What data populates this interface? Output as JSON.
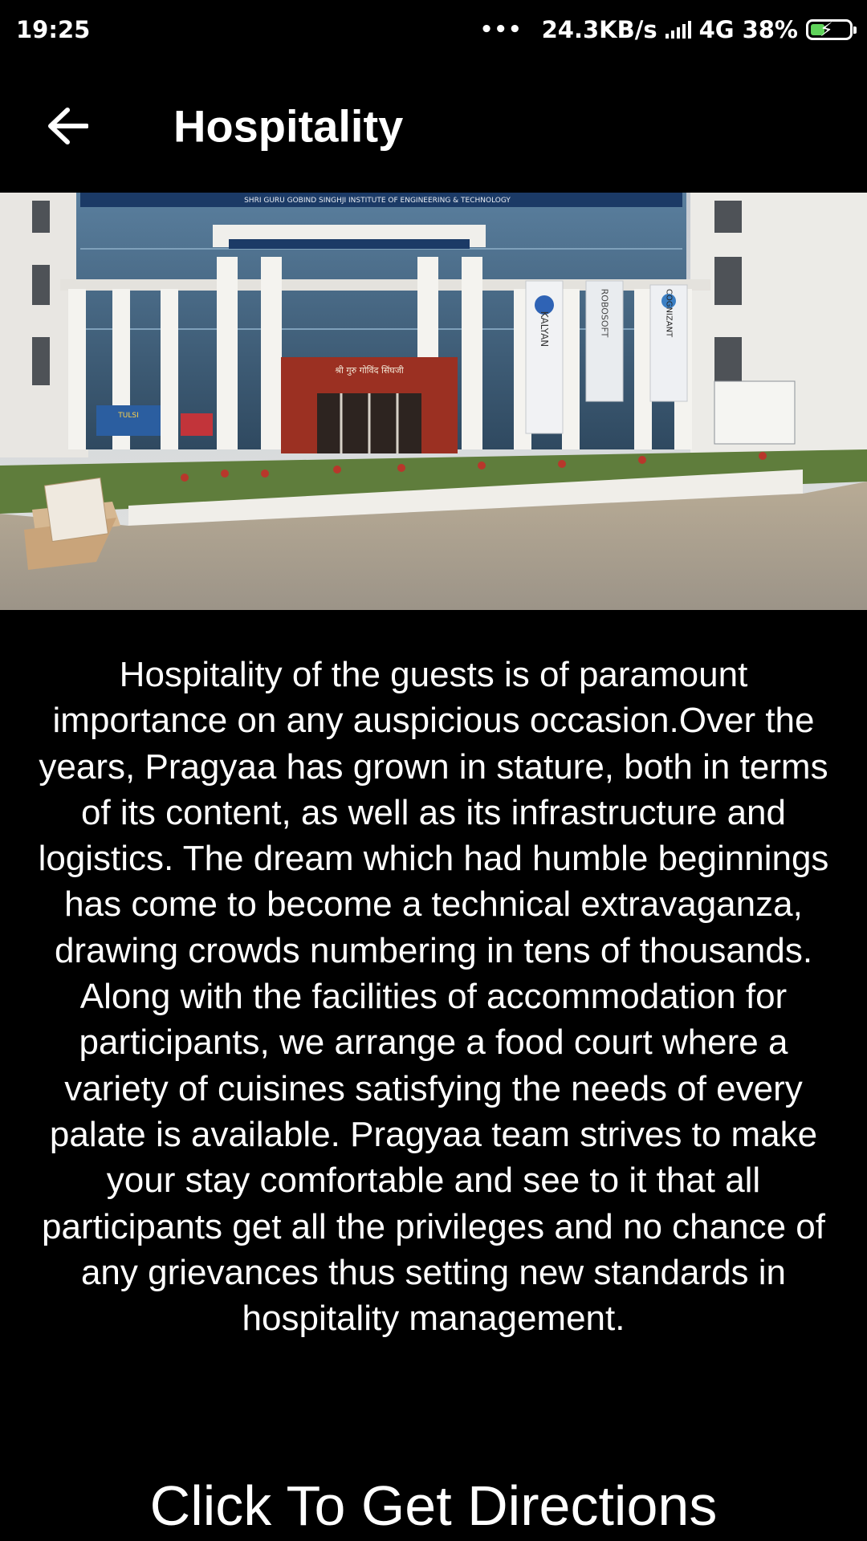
{
  "status_bar": {
    "time": "19:25",
    "network_speed": "24.3KB/s",
    "network_type": "4G",
    "battery_percent": "38%",
    "battery_level": 0.38,
    "battery_charging": true
  },
  "app_bar": {
    "title": "Hospitality",
    "back_icon": "arrow-left-icon"
  },
  "hero_image": {
    "banner_text": "SHRI GURU GOBIND SINGHJI INSTITUTE OF ENGINEERING & TECHNOLOGY",
    "hindi_sign": "श्री गुरु गोविंद सिंघजी",
    "banner_left": "KALYAN",
    "banner_mid": "ROBOSOFT",
    "banner_right": "COGNIZANT",
    "small_sign": "TULSI"
  },
  "content": {
    "description": "Hospitality of the guests is of paramount importance on any auspicious occasion.Over the years, Pragyaa has grown in stature, both in terms of its content, as well as its infrastructure and logistics. The dream which had humble beginnings has come to become a technical extravaganza, drawing crowds numbering in tens of thousands. Along with the facilities of accommodation for participants, we arrange a food court where a variety of cuisines satisfying the needs of every palate is available. Pragyaa team strives to make your stay comfortable and see to it that all participants get all the privileges and no chance of any grievances thus setting new standards in hospitality management."
  },
  "directions_button": {
    "label": "Click To Get Directions"
  }
}
